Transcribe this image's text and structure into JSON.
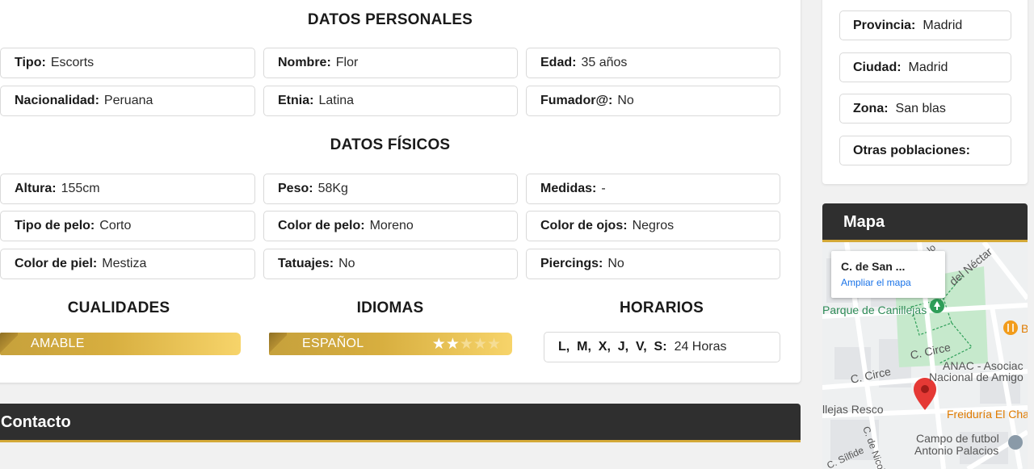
{
  "personal": {
    "title": "DATOS PERSONALES",
    "fields": [
      {
        "label": "Tipo:",
        "value": "Escorts"
      },
      {
        "label": "Nombre:",
        "value": "Flor"
      },
      {
        "label": "Edad:",
        "value": "35 años"
      },
      {
        "label": "Nacionalidad:",
        "value": "Peruana"
      },
      {
        "label": "Etnia:",
        "value": "Latina"
      },
      {
        "label": "Fumador@:",
        "value": "No"
      }
    ]
  },
  "physical": {
    "title": "DATOS FÍSICOS",
    "fields": [
      {
        "label": "Altura:",
        "value": "155cm"
      },
      {
        "label": "Peso:",
        "value": "58Kg"
      },
      {
        "label": "Medidas:",
        "value": "-"
      },
      {
        "label": "Tipo de pelo:",
        "value": "Corto"
      },
      {
        "label": "Color de pelo:",
        "value": "Moreno"
      },
      {
        "label": "Color de ojos:",
        "value": "Negros"
      },
      {
        "label": "Color de piel:",
        "value": "Mestiza"
      },
      {
        "label": "Tatuajes:",
        "value": "No"
      },
      {
        "label": "Piercings:",
        "value": "No"
      }
    ]
  },
  "qualities": {
    "title": "CUALIDADES",
    "items": [
      "AMABLE"
    ]
  },
  "languages": {
    "title": "IDIOMAS",
    "items": [
      {
        "name": "ESPAÑOL",
        "stars": 2,
        "max_stars": 5
      }
    ]
  },
  "schedule": {
    "title": "HORARIOS",
    "days": "L,  M,  X,  J,  V,  S:",
    "hours": "24 Horas"
  },
  "contact": {
    "title": "Contacto"
  },
  "location": {
    "fields": [
      {
        "label": "Provincia:",
        "value": "Madrid"
      },
      {
        "label": "Ciudad:",
        "value": "Madrid"
      },
      {
        "label": "Zona:",
        "value": "San blas"
      },
      {
        "label": "Otras poblaciones:",
        "value": ""
      }
    ]
  },
  "map": {
    "title": "Mapa",
    "place": "C. de San ...",
    "link": "Ampliar el mapa",
    "labels": {
      "park": "Parque de Canillejas",
      "nectar": "del Néctar",
      "street1": "C. Circe",
      "street2": "C. Circe",
      "anac1": "ANAC - Asociac",
      "anac2": "Nacional de Amigo",
      "resco": "llejas Resco",
      "freid": "Freiduría El Cha",
      "campo1": "Campo de futbol",
      "campo2": "Antonio Palacios",
      "sn": "C. de Nicol",
      "silfide": "C. Sílfide",
      "lo": "lo",
      "b": "B"
    }
  },
  "colors": {
    "accent": "#d4a938",
    "dark_bar": "#2f2f2f"
  }
}
